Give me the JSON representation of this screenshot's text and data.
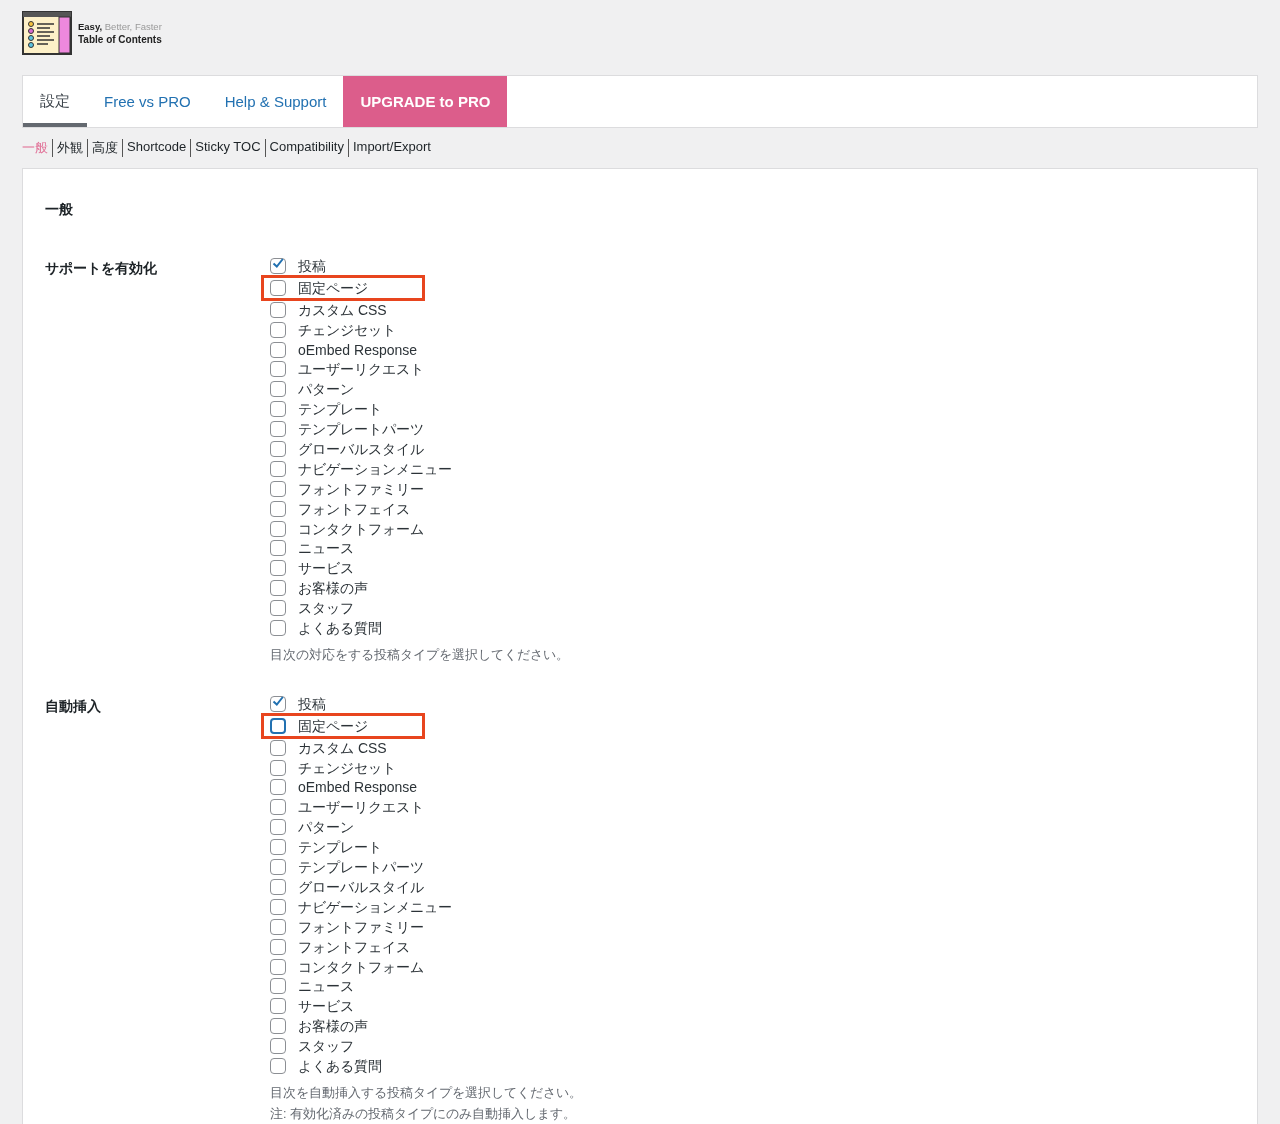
{
  "logo": {
    "tagline": [
      {
        "text": "Easy",
        "kind": "strong"
      },
      {
        "text": ", ",
        "kind": "strong"
      },
      {
        "text": "Better, ",
        "kind": "mid"
      },
      {
        "text": "Faster",
        "kind": "faint"
      }
    ],
    "title": "Table of Contents"
  },
  "tabs": [
    {
      "label": "設定",
      "selected": true,
      "kind": "tab"
    },
    {
      "label": "Free vs PRO",
      "selected": false,
      "kind": "link"
    },
    {
      "label": "Help & Support",
      "selected": false,
      "kind": "link"
    },
    {
      "label": "UPGRADE to PRO",
      "selected": false,
      "kind": "upgrade"
    }
  ],
  "subnav": [
    {
      "label": "一般",
      "selected": true
    },
    {
      "label": "外観",
      "selected": false
    },
    {
      "label": "高度",
      "selected": false
    },
    {
      "label": "Shortcode",
      "selected": false
    },
    {
      "label": "Sticky TOC",
      "selected": false
    },
    {
      "label": "Compatibility",
      "selected": false
    },
    {
      "label": "Import/Export",
      "selected": false
    }
  ],
  "section_title": "一般",
  "settings": [
    {
      "label": "サポートを有効化",
      "options": [
        {
          "label": "投稿",
          "checked": true,
          "focused": false,
          "highlighted": false
        },
        {
          "label": "固定ページ",
          "checked": false,
          "focused": false,
          "highlighted": true
        },
        {
          "label": "カスタム CSS",
          "checked": false,
          "focused": false,
          "highlighted": false
        },
        {
          "label": "チェンジセット",
          "checked": false,
          "focused": false,
          "highlighted": false
        },
        {
          "label": "oEmbed Response",
          "checked": false,
          "focused": false,
          "highlighted": false
        },
        {
          "label": "ユーザーリクエスト",
          "checked": false,
          "focused": false,
          "highlighted": false
        },
        {
          "label": "パターン",
          "checked": false,
          "focused": false,
          "highlighted": false
        },
        {
          "label": "テンプレート",
          "checked": false,
          "focused": false,
          "highlighted": false
        },
        {
          "label": "テンプレートパーツ",
          "checked": false,
          "focused": false,
          "highlighted": false
        },
        {
          "label": "グローバルスタイル",
          "checked": false,
          "focused": false,
          "highlighted": false
        },
        {
          "label": "ナビゲーションメニュー",
          "checked": false,
          "focused": false,
          "highlighted": false
        },
        {
          "label": "フォントファミリー",
          "checked": false,
          "focused": false,
          "highlighted": false
        },
        {
          "label": "フォントフェイス",
          "checked": false,
          "focused": false,
          "highlighted": false
        },
        {
          "label": "コンタクトフォーム",
          "checked": false,
          "focused": false,
          "highlighted": false
        },
        {
          "label": "ニュース",
          "checked": false,
          "focused": false,
          "highlighted": false
        },
        {
          "label": "サービス",
          "checked": false,
          "focused": false,
          "highlighted": false
        },
        {
          "label": "お客様の声",
          "checked": false,
          "focused": false,
          "highlighted": false
        },
        {
          "label": "スタッフ",
          "checked": false,
          "focused": false,
          "highlighted": false
        },
        {
          "label": "よくある質問",
          "checked": false,
          "focused": false,
          "highlighted": false
        }
      ],
      "notes": [
        "目次の対応をする投稿タイプを選択してください。"
      ]
    },
    {
      "label": "自動挿入",
      "options": [
        {
          "label": "投稿",
          "checked": true,
          "focused": false,
          "highlighted": false
        },
        {
          "label": "固定ページ",
          "checked": false,
          "focused": true,
          "highlighted": true
        },
        {
          "label": "カスタム CSS",
          "checked": false,
          "focused": false,
          "highlighted": false
        },
        {
          "label": "チェンジセット",
          "checked": false,
          "focused": false,
          "highlighted": false
        },
        {
          "label": "oEmbed Response",
          "checked": false,
          "focused": false,
          "highlighted": false
        },
        {
          "label": "ユーザーリクエスト",
          "checked": false,
          "focused": false,
          "highlighted": false
        },
        {
          "label": "パターン",
          "checked": false,
          "focused": false,
          "highlighted": false
        },
        {
          "label": "テンプレート",
          "checked": false,
          "focused": false,
          "highlighted": false
        },
        {
          "label": "テンプレートパーツ",
          "checked": false,
          "focused": false,
          "highlighted": false
        },
        {
          "label": "グローバルスタイル",
          "checked": false,
          "focused": false,
          "highlighted": false
        },
        {
          "label": "ナビゲーションメニュー",
          "checked": false,
          "focused": false,
          "highlighted": false
        },
        {
          "label": "フォントファミリー",
          "checked": false,
          "focused": false,
          "highlighted": false
        },
        {
          "label": "フォントフェイス",
          "checked": false,
          "focused": false,
          "highlighted": false
        },
        {
          "label": "コンタクトフォーム",
          "checked": false,
          "focused": false,
          "highlighted": false
        },
        {
          "label": "ニュース",
          "checked": false,
          "focused": false,
          "highlighted": false
        },
        {
          "label": "サービス",
          "checked": false,
          "focused": false,
          "highlighted": false
        },
        {
          "label": "お客様の声",
          "checked": false,
          "focused": false,
          "highlighted": false
        },
        {
          "label": "スタッフ",
          "checked": false,
          "focused": false,
          "highlighted": false
        },
        {
          "label": "よくある質問",
          "checked": false,
          "focused": false,
          "highlighted": false
        }
      ],
      "notes": [
        "目次を自動挿入する投稿タイプを選択してください。",
        "注: 有効化済みの投稿タイプにのみ自動挿入します。"
      ]
    }
  ]
}
